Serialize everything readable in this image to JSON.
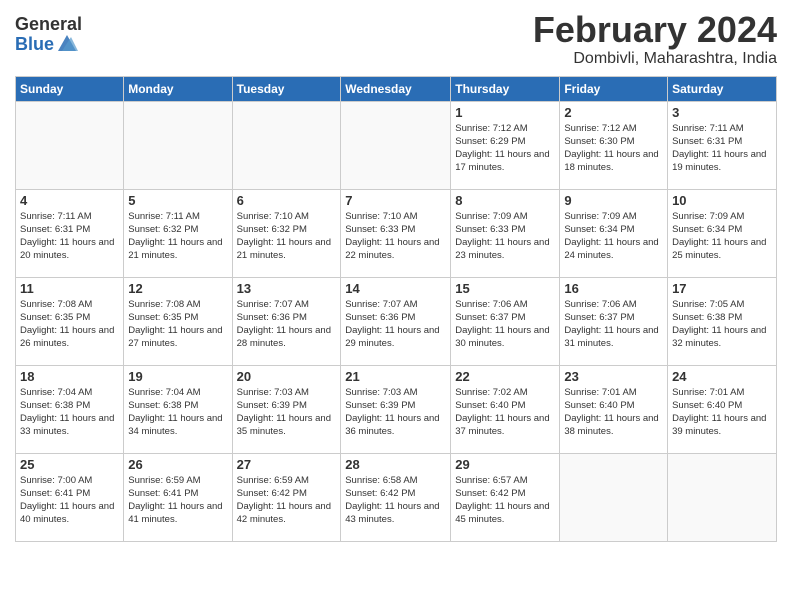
{
  "logo": {
    "general": "General",
    "blue": "Blue"
  },
  "title": "February 2024",
  "subtitle": "Dombivli, Maharashtra, India",
  "days_of_week": [
    "Sunday",
    "Monday",
    "Tuesday",
    "Wednesday",
    "Thursday",
    "Friday",
    "Saturday"
  ],
  "weeks": [
    [
      {
        "num": "",
        "sunrise": "",
        "sunset": "",
        "daylight": ""
      },
      {
        "num": "",
        "sunrise": "",
        "sunset": "",
        "daylight": ""
      },
      {
        "num": "",
        "sunrise": "",
        "sunset": "",
        "daylight": ""
      },
      {
        "num": "",
        "sunrise": "",
        "sunset": "",
        "daylight": ""
      },
      {
        "num": "1",
        "sunrise": "7:12 AM",
        "sunset": "6:29 PM",
        "daylight": "11 hours and 17 minutes."
      },
      {
        "num": "2",
        "sunrise": "7:12 AM",
        "sunset": "6:30 PM",
        "daylight": "11 hours and 18 minutes."
      },
      {
        "num": "3",
        "sunrise": "7:11 AM",
        "sunset": "6:31 PM",
        "daylight": "11 hours and 19 minutes."
      }
    ],
    [
      {
        "num": "4",
        "sunrise": "7:11 AM",
        "sunset": "6:31 PM",
        "daylight": "11 hours and 20 minutes."
      },
      {
        "num": "5",
        "sunrise": "7:11 AM",
        "sunset": "6:32 PM",
        "daylight": "11 hours and 21 minutes."
      },
      {
        "num": "6",
        "sunrise": "7:10 AM",
        "sunset": "6:32 PM",
        "daylight": "11 hours and 21 minutes."
      },
      {
        "num": "7",
        "sunrise": "7:10 AM",
        "sunset": "6:33 PM",
        "daylight": "11 hours and 22 minutes."
      },
      {
        "num": "8",
        "sunrise": "7:09 AM",
        "sunset": "6:33 PM",
        "daylight": "11 hours and 23 minutes."
      },
      {
        "num": "9",
        "sunrise": "7:09 AM",
        "sunset": "6:34 PM",
        "daylight": "11 hours and 24 minutes."
      },
      {
        "num": "10",
        "sunrise": "7:09 AM",
        "sunset": "6:34 PM",
        "daylight": "11 hours and 25 minutes."
      }
    ],
    [
      {
        "num": "11",
        "sunrise": "7:08 AM",
        "sunset": "6:35 PM",
        "daylight": "11 hours and 26 minutes."
      },
      {
        "num": "12",
        "sunrise": "7:08 AM",
        "sunset": "6:35 PM",
        "daylight": "11 hours and 27 minutes."
      },
      {
        "num": "13",
        "sunrise": "7:07 AM",
        "sunset": "6:36 PM",
        "daylight": "11 hours and 28 minutes."
      },
      {
        "num": "14",
        "sunrise": "7:07 AM",
        "sunset": "6:36 PM",
        "daylight": "11 hours and 29 minutes."
      },
      {
        "num": "15",
        "sunrise": "7:06 AM",
        "sunset": "6:37 PM",
        "daylight": "11 hours and 30 minutes."
      },
      {
        "num": "16",
        "sunrise": "7:06 AM",
        "sunset": "6:37 PM",
        "daylight": "11 hours and 31 minutes."
      },
      {
        "num": "17",
        "sunrise": "7:05 AM",
        "sunset": "6:38 PM",
        "daylight": "11 hours and 32 minutes."
      }
    ],
    [
      {
        "num": "18",
        "sunrise": "7:04 AM",
        "sunset": "6:38 PM",
        "daylight": "11 hours and 33 minutes."
      },
      {
        "num": "19",
        "sunrise": "7:04 AM",
        "sunset": "6:38 PM",
        "daylight": "11 hours and 34 minutes."
      },
      {
        "num": "20",
        "sunrise": "7:03 AM",
        "sunset": "6:39 PM",
        "daylight": "11 hours and 35 minutes."
      },
      {
        "num": "21",
        "sunrise": "7:03 AM",
        "sunset": "6:39 PM",
        "daylight": "11 hours and 36 minutes."
      },
      {
        "num": "22",
        "sunrise": "7:02 AM",
        "sunset": "6:40 PM",
        "daylight": "11 hours and 37 minutes."
      },
      {
        "num": "23",
        "sunrise": "7:01 AM",
        "sunset": "6:40 PM",
        "daylight": "11 hours and 38 minutes."
      },
      {
        "num": "24",
        "sunrise": "7:01 AM",
        "sunset": "6:40 PM",
        "daylight": "11 hours and 39 minutes."
      }
    ],
    [
      {
        "num": "25",
        "sunrise": "7:00 AM",
        "sunset": "6:41 PM",
        "daylight": "11 hours and 40 minutes."
      },
      {
        "num": "26",
        "sunrise": "6:59 AM",
        "sunset": "6:41 PM",
        "daylight": "11 hours and 41 minutes."
      },
      {
        "num": "27",
        "sunrise": "6:59 AM",
        "sunset": "6:42 PM",
        "daylight": "11 hours and 42 minutes."
      },
      {
        "num": "28",
        "sunrise": "6:58 AM",
        "sunset": "6:42 PM",
        "daylight": "11 hours and 43 minutes."
      },
      {
        "num": "29",
        "sunrise": "6:57 AM",
        "sunset": "6:42 PM",
        "daylight": "11 hours and 45 minutes."
      },
      {
        "num": "",
        "sunrise": "",
        "sunset": "",
        "daylight": ""
      },
      {
        "num": "",
        "sunrise": "",
        "sunset": "",
        "daylight": ""
      }
    ]
  ]
}
